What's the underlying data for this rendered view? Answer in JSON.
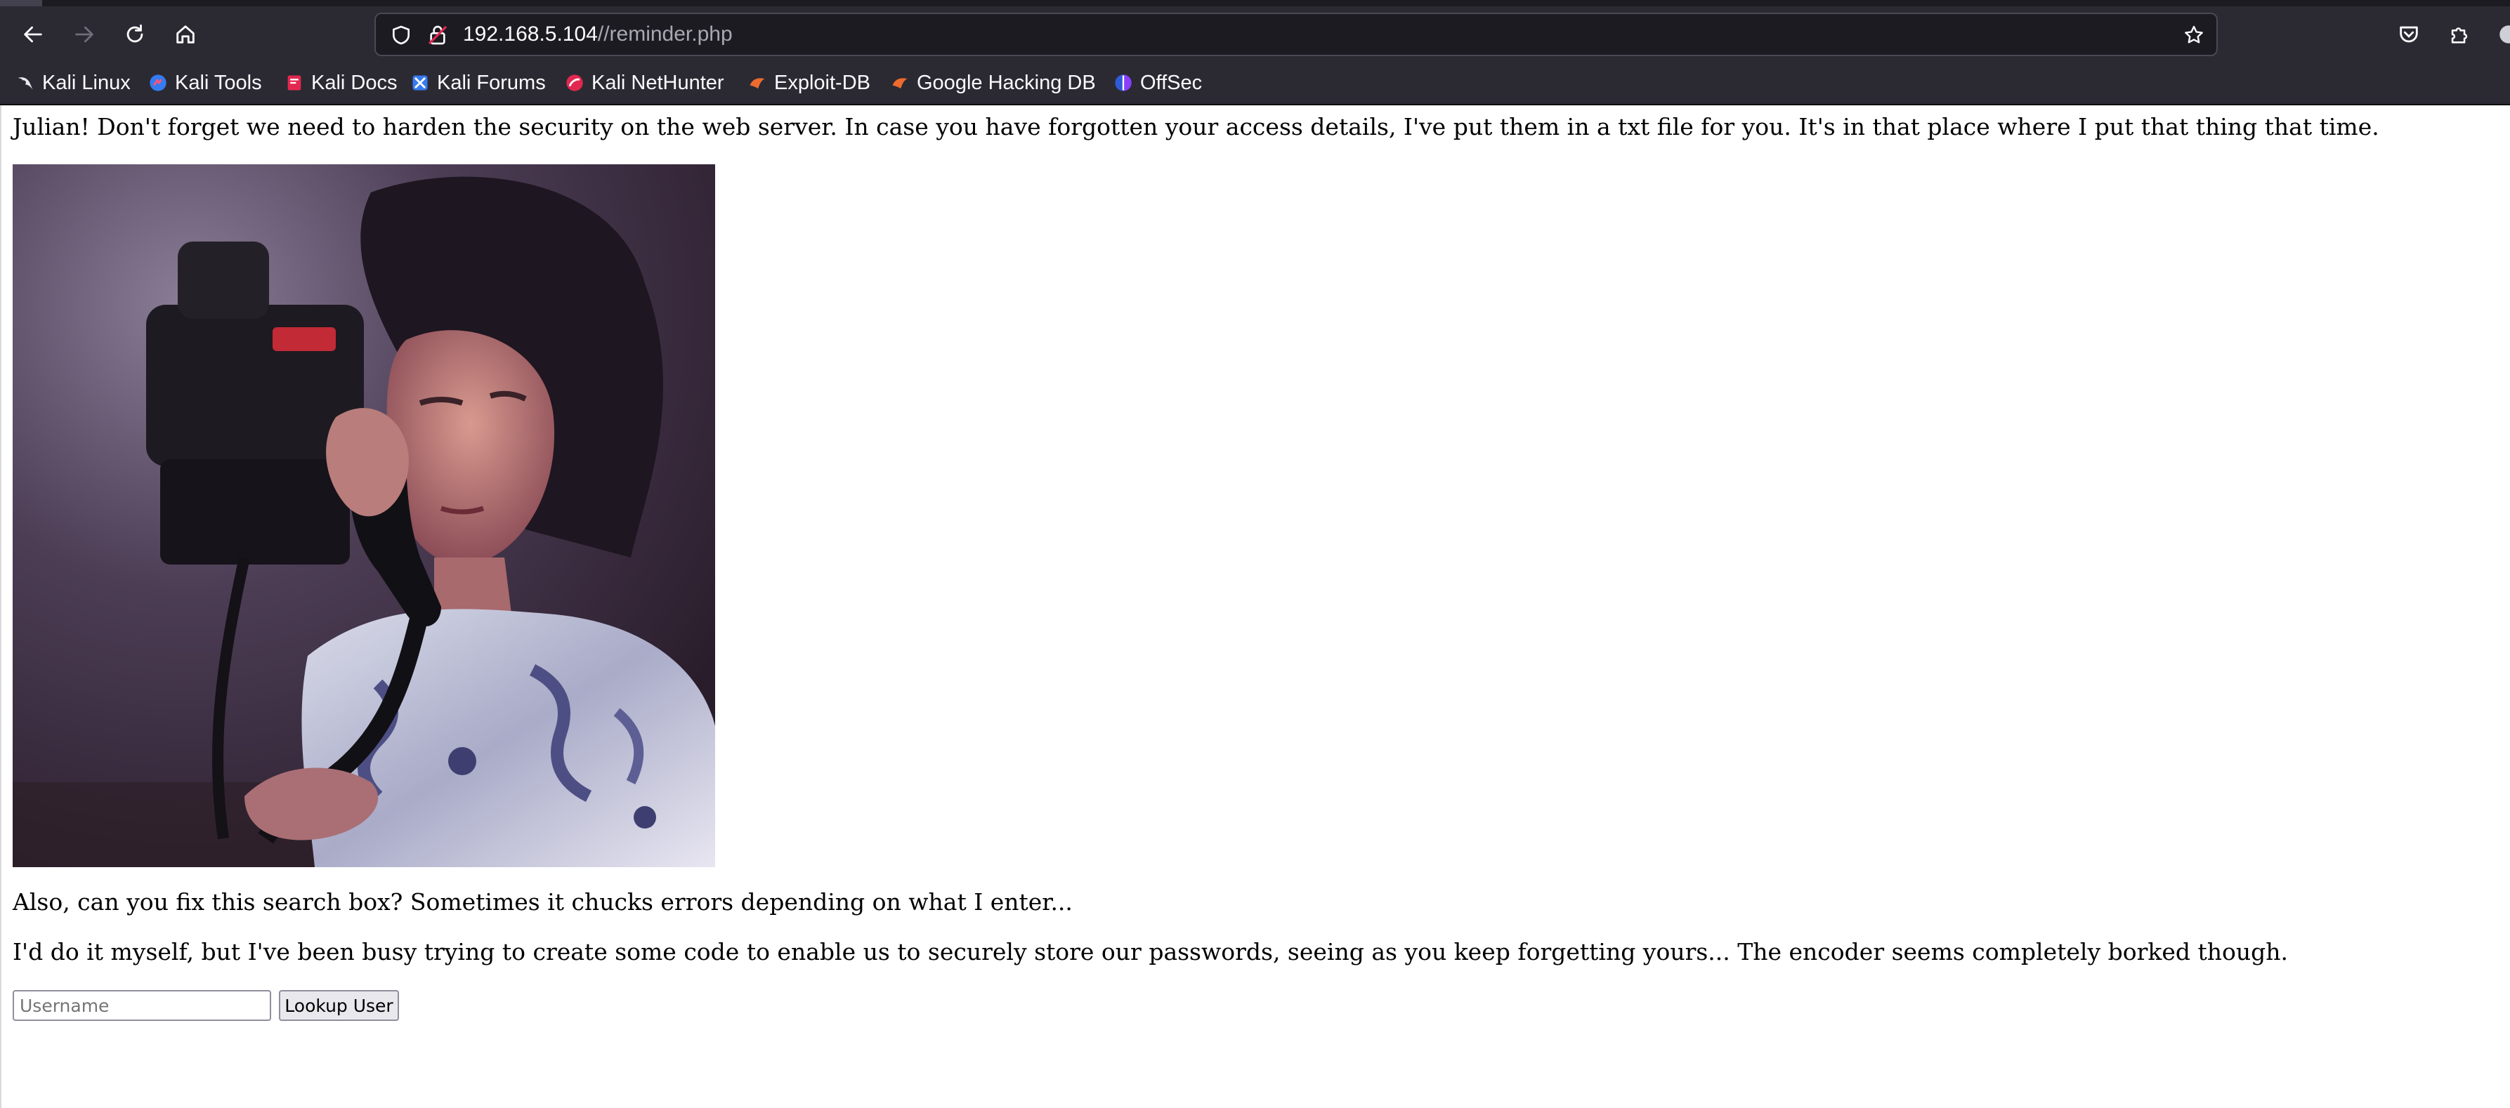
{
  "browser": {
    "url_host": "192.168.5.104",
    "url_path": "//reminder.php",
    "bookmarks": [
      {
        "label": "Kali Linux",
        "icon": "kali-dragon-icon"
      },
      {
        "label": "Kali Tools",
        "icon": "kali-tools-icon"
      },
      {
        "label": "Kali Docs",
        "icon": "kali-docs-icon"
      },
      {
        "label": "Kali Forums",
        "icon": "kali-forums-icon"
      },
      {
        "label": "Kali NetHunter",
        "icon": "nethunter-icon"
      },
      {
        "label": "Exploit-DB",
        "icon": "exploit-db-icon"
      },
      {
        "label": "Google Hacking DB",
        "icon": "ghdb-icon"
      },
      {
        "label": "OffSec",
        "icon": "offsec-icon"
      }
    ]
  },
  "page": {
    "message_1": "Julian! Don't forget we need to harden the security on the web server. In case you have forgotten your access details, I've put them in a txt file for you. It's in that place where I put that thing that time.",
    "message_2": "Also, can you fix this search box? Sometimes it chucks errors depending on what I enter...",
    "message_3": "I'd do it myself, but I've been busy trying to create some code to enable us to securely store our passwords, seeing as you keep forgetting yours... The encoder seems completely borked though.",
    "form": {
      "username_placeholder": "Username",
      "username_value": "",
      "submit_label": "Lookup User"
    }
  },
  "colors": {
    "chrome_bg": "#2b2a33",
    "urlbar_bg": "#1c1b22",
    "page_bg": "#ffffff"
  }
}
